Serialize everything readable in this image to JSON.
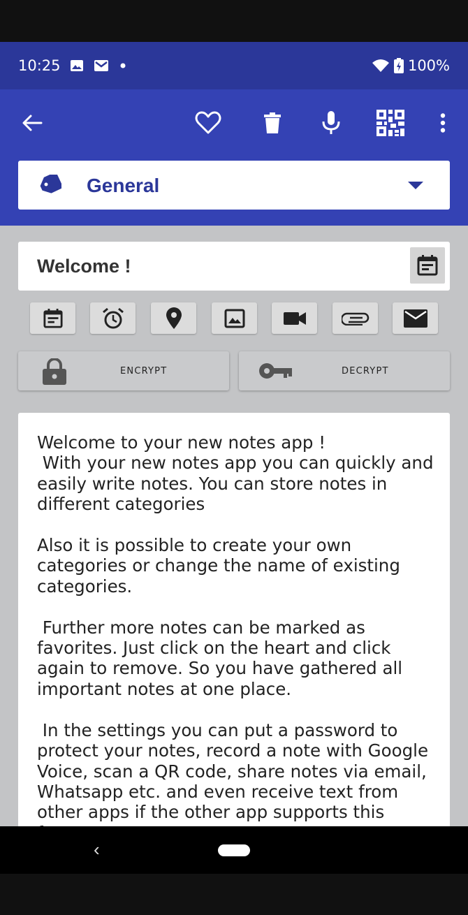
{
  "status_bar": {
    "time": "10:25",
    "battery": "100%"
  },
  "toolbar": {
    "icons": [
      "back-arrow-icon",
      "heart-icon",
      "trash-icon",
      "mic-icon",
      "qr-code-icon",
      "more-vert-icon"
    ]
  },
  "category": {
    "label": "General"
  },
  "note": {
    "title": "Welcome !",
    "body": "Welcome to your new notes app !\n With your new notes app you can quickly and easily write notes. You can store notes in different categories\n\nAlso it is possible to create your own categories or change the name of existing categories.\n\n Further more notes can be marked as favorites. Just click on the heart and click again to remove. So you have gathered all important notes at one place.\n\n In the settings you can put a password to protect your notes, record a note with Google Voice, scan a QR code, share notes via email, Whatsapp etc. and even receive text from other apps if the other app supports this feature."
  },
  "attachments": {
    "icons": [
      "calendar-icon",
      "alarm-icon",
      "location-icon",
      "image-icon",
      "video-icon",
      "attachment-icon",
      "email-icon"
    ]
  },
  "crypto": {
    "encrypt_label": "ENCRYPT",
    "decrypt_label": "DECRYPT"
  },
  "colors": {
    "primary": "#3442b4",
    "primary_dark": "#2b3799",
    "background": "#c3c4c6"
  }
}
